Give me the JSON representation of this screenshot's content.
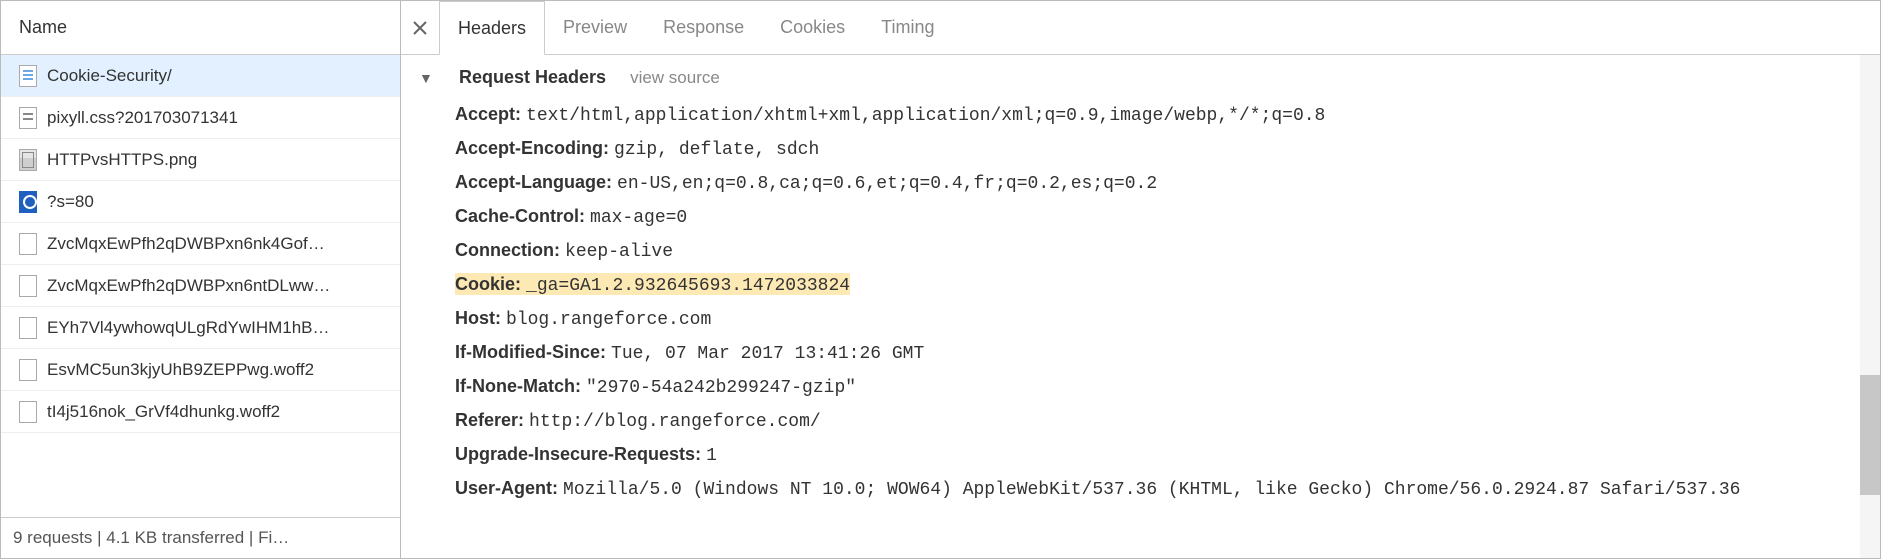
{
  "left": {
    "column_header": "Name",
    "requests": [
      {
        "name": "Cookie-Security/",
        "icon": "doc",
        "selected": true
      },
      {
        "name": "pixyll.css?201703071341",
        "icon": "css",
        "selected": false
      },
      {
        "name": "HTTPvsHTTPS.png",
        "icon": "img",
        "selected": false
      },
      {
        "name": "?s=80",
        "icon": "favicon",
        "selected": false
      },
      {
        "name": "ZvcMqxEwPfh2qDWBPxn6nk4Gof…",
        "icon": "blank",
        "selected": false
      },
      {
        "name": "ZvcMqxEwPfh2qDWBPxn6ntDLww…",
        "icon": "blank",
        "selected": false
      },
      {
        "name": "EYh7Vl4ywhowqULgRdYwIHM1hB…",
        "icon": "blank",
        "selected": false
      },
      {
        "name": "EsvMC5un3kjyUhB9ZEPPwg.woff2",
        "icon": "blank",
        "selected": false
      },
      {
        "name": "tI4j516nok_GrVf4dhunkg.woff2",
        "icon": "blank",
        "selected": false
      }
    ],
    "footer": "9 requests  |  4.1 KB transferred  |  Fi…"
  },
  "tabs": {
    "items": [
      {
        "label": "Headers",
        "active": true
      },
      {
        "label": "Preview",
        "active": false
      },
      {
        "label": "Response",
        "active": false
      },
      {
        "label": "Cookies",
        "active": false
      },
      {
        "label": "Timing",
        "active": false
      }
    ]
  },
  "section": {
    "title": "Request Headers",
    "view_source": "view source"
  },
  "headers": [
    {
      "name": "Accept:",
      "value": "text/html,application/xhtml+xml,application/xml;q=0.9,image/webp,*/*;q=0.8",
      "highlight": false
    },
    {
      "name": "Accept-Encoding:",
      "value": "gzip, deflate, sdch",
      "highlight": false
    },
    {
      "name": "Accept-Language:",
      "value": "en-US,en;q=0.8,ca;q=0.6,et;q=0.4,fr;q=0.2,es;q=0.2",
      "highlight": false
    },
    {
      "name": "Cache-Control:",
      "value": "max-age=0",
      "highlight": false
    },
    {
      "name": "Connection:",
      "value": "keep-alive",
      "highlight": false
    },
    {
      "name": "Cookie:",
      "value": "_ga=GA1.2.932645693.1472033824",
      "highlight": true
    },
    {
      "name": "Host:",
      "value": "blog.rangeforce.com",
      "highlight": false
    },
    {
      "name": "If-Modified-Since:",
      "value": "Tue, 07 Mar 2017 13:41:26 GMT",
      "highlight": false
    },
    {
      "name": "If-None-Match:",
      "value": "\"2970-54a242b299247-gzip\"",
      "highlight": false
    },
    {
      "name": "Referer:",
      "value": "http://blog.rangeforce.com/",
      "highlight": false
    },
    {
      "name": "Upgrade-Insecure-Requests:",
      "value": "1",
      "highlight": false
    },
    {
      "name": "User-Agent:",
      "value": "Mozilla/5.0 (Windows NT 10.0; WOW64) AppleWebKit/537.36 (KHTML, like Gecko) Chrome/56.0.2924.87 Safari/537.36",
      "highlight": false
    }
  ]
}
